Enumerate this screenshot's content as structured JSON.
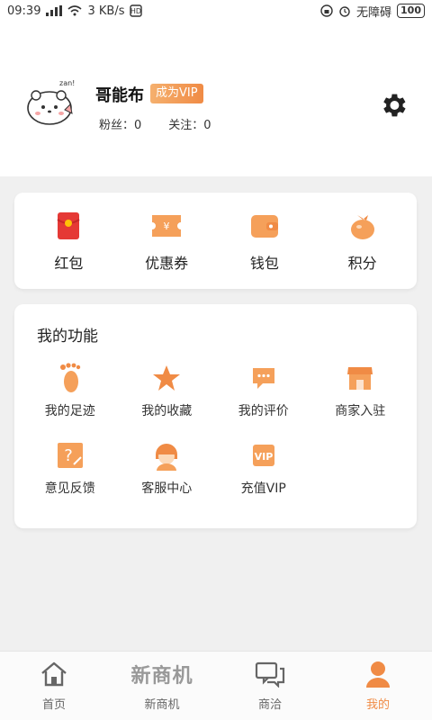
{
  "status_bar": {
    "time": "09:39",
    "network_speed": "3 KB/s",
    "carrier": "无障碍",
    "battery": "100"
  },
  "profile": {
    "username": "哥能布",
    "vip_badge": "成为VIP",
    "fans_label": "粉丝：0",
    "following_label": "关注：0",
    "avatar_text": "zan!"
  },
  "wallet": {
    "items": [
      {
        "label": "红包",
        "icon": "red-packet-icon"
      },
      {
        "label": "优惠券",
        "icon": "coupon-icon"
      },
      {
        "label": "钱包",
        "icon": "wallet-icon"
      },
      {
        "label": "积分",
        "icon": "points-icon"
      }
    ]
  },
  "functions": {
    "title": "我的功能",
    "items": [
      {
        "label": "我的足迹",
        "icon": "footprint-icon"
      },
      {
        "label": "我的收藏",
        "icon": "star-icon"
      },
      {
        "label": "我的评价",
        "icon": "comment-icon"
      },
      {
        "label": "商家入驻",
        "icon": "store-icon"
      },
      {
        "label": "意见反馈",
        "icon": "feedback-icon"
      },
      {
        "label": "客服中心",
        "icon": "customer-service-icon"
      },
      {
        "label": "充值VIP",
        "icon": "vip-icon"
      }
    ]
  },
  "tabbar": {
    "items": [
      {
        "label": "首页",
        "icon": "home-icon"
      },
      {
        "label": "新商机",
        "icon": "brand-text-icon"
      },
      {
        "label": "商洽",
        "icon": "chat-icon"
      },
      {
        "label": "我的",
        "icon": "user-icon",
        "active": true
      }
    ],
    "brand_text": "新商机"
  },
  "colors": {
    "accent": "#f08b45",
    "accent_light": "#f5b06e",
    "red": "#e53935"
  }
}
